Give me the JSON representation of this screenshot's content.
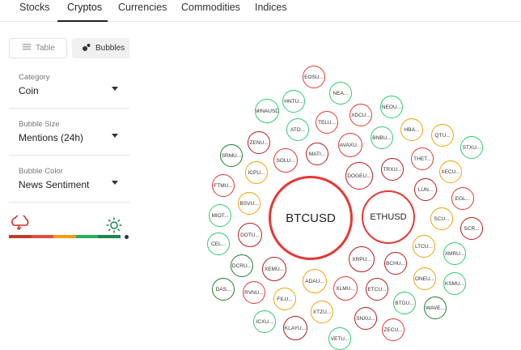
{
  "tabs": [
    {
      "label": "Stocks",
      "active": false
    },
    {
      "label": "Cryptos",
      "active": true
    },
    {
      "label": "Currencies",
      "active": false
    },
    {
      "label": "Commodities",
      "active": false
    },
    {
      "label": "Indices",
      "active": false
    }
  ],
  "view_toggle": {
    "table_label": "Table",
    "bubbles_label": "Bubbles",
    "selected": "Bubbles"
  },
  "controls": {
    "category": {
      "label": "Category",
      "value": "Coin"
    },
    "bubble_size": {
      "label": "Bubble Size",
      "value": "Mentions (24h)"
    },
    "bubble_color": {
      "label": "Bubble Color",
      "value": "News Sentiment"
    }
  },
  "sentiment_legend": {
    "negative_icon": "storm-cloud-icon",
    "positive_icon": "sun-icon",
    "colors": [
      "#c0392b",
      "#e74c3c",
      "#f39c12",
      "#27ae60",
      "#1e8449"
    ]
  },
  "colors": {
    "dark_red": "#b71c1c",
    "red": "#e53935",
    "orange": "#f0a30a",
    "green": "#2ecc71",
    "dark_green": "#1e7e34"
  },
  "bubbles": [
    {
      "label": "BTCUSD",
      "color": "red"
    },
    {
      "label": "ETHUSD",
      "color": "red"
    },
    {
      "label": "EOSU...",
      "color": "red"
    },
    {
      "label": "NEA...",
      "color": "green"
    },
    {
      "label": "HNTU...",
      "color": "green"
    },
    {
      "label": "MINAUSD",
      "color": "green"
    },
    {
      "label": "XDCU...",
      "color": "red"
    },
    {
      "label": "NEOU...",
      "color": "green"
    },
    {
      "label": "TELU...",
      "color": "red"
    },
    {
      "label": "ATO...",
      "color": "green"
    },
    {
      "label": "BNBU...",
      "color": "green"
    },
    {
      "label": "HBA...",
      "color": "orange"
    },
    {
      "label": "QTU...",
      "color": "orange"
    },
    {
      "label": "STXU...",
      "color": "green"
    },
    {
      "label": "ZENU...",
      "color": "dark_red"
    },
    {
      "label": "MATI...",
      "color": "dark_red"
    },
    {
      "label": "AVAXU...",
      "color": "red"
    },
    {
      "label": "SRMU...",
      "color": "dark_green"
    },
    {
      "label": "SOLU...",
      "color": "red"
    },
    {
      "label": "THET...",
      "color": "red"
    },
    {
      "label": "TRXU...",
      "color": "dark_red"
    },
    {
      "label": "XECU...",
      "color": "orange"
    },
    {
      "label": "ICPU...",
      "color": "orange"
    },
    {
      "label": "DOGEU...",
      "color": "dark_red"
    },
    {
      "label": "FTMU...",
      "color": "red"
    },
    {
      "label": "LUN...",
      "color": "dark_red"
    },
    {
      "label": "EGL...",
      "color": "red"
    },
    {
      "label": "BSVU...",
      "color": "orange"
    },
    {
      "label": "MIOT...",
      "color": "green"
    },
    {
      "label": "SCU...",
      "color": "orange"
    },
    {
      "label": "SCR...",
      "color": "dark_red"
    },
    {
      "label": "DOTU...",
      "color": "dark_red"
    },
    {
      "label": "CEL...",
      "color": "green"
    },
    {
      "label": "LTCU...",
      "color": "orange"
    },
    {
      "label": "XMRU...",
      "color": "green"
    },
    {
      "label": "XRPU...",
      "color": "dark_red"
    },
    {
      "label": "BCHU...",
      "color": "dark_red"
    },
    {
      "label": "DCRU...",
      "color": "dark_green"
    },
    {
      "label": "XEMU...",
      "color": "dark_red"
    },
    {
      "label": "ONEU...",
      "color": "orange"
    },
    {
      "label": "KSMU...",
      "color": "green"
    },
    {
      "label": "ADAU...",
      "color": "orange"
    },
    {
      "label": "DAS...",
      "color": "dark_green"
    },
    {
      "label": "RVNU...",
      "color": "red"
    },
    {
      "label": "XLMU...",
      "color": "red"
    },
    {
      "label": "ETCU...",
      "color": "dark_red"
    },
    {
      "label": "FILU...",
      "color": "orange"
    },
    {
      "label": "BTGU...",
      "color": "green"
    },
    {
      "label": "WAVE...",
      "color": "dark_green"
    },
    {
      "label": "XTZU...",
      "color": "orange"
    },
    {
      "label": "ICXU...",
      "color": "green"
    },
    {
      "label": "SNXU...",
      "color": "dark_red"
    },
    {
      "label": "KLAYU...",
      "color": "dark_red"
    },
    {
      "label": "ZECU...",
      "color": "red"
    },
    {
      "label": "VETU...",
      "color": "green"
    }
  ]
}
